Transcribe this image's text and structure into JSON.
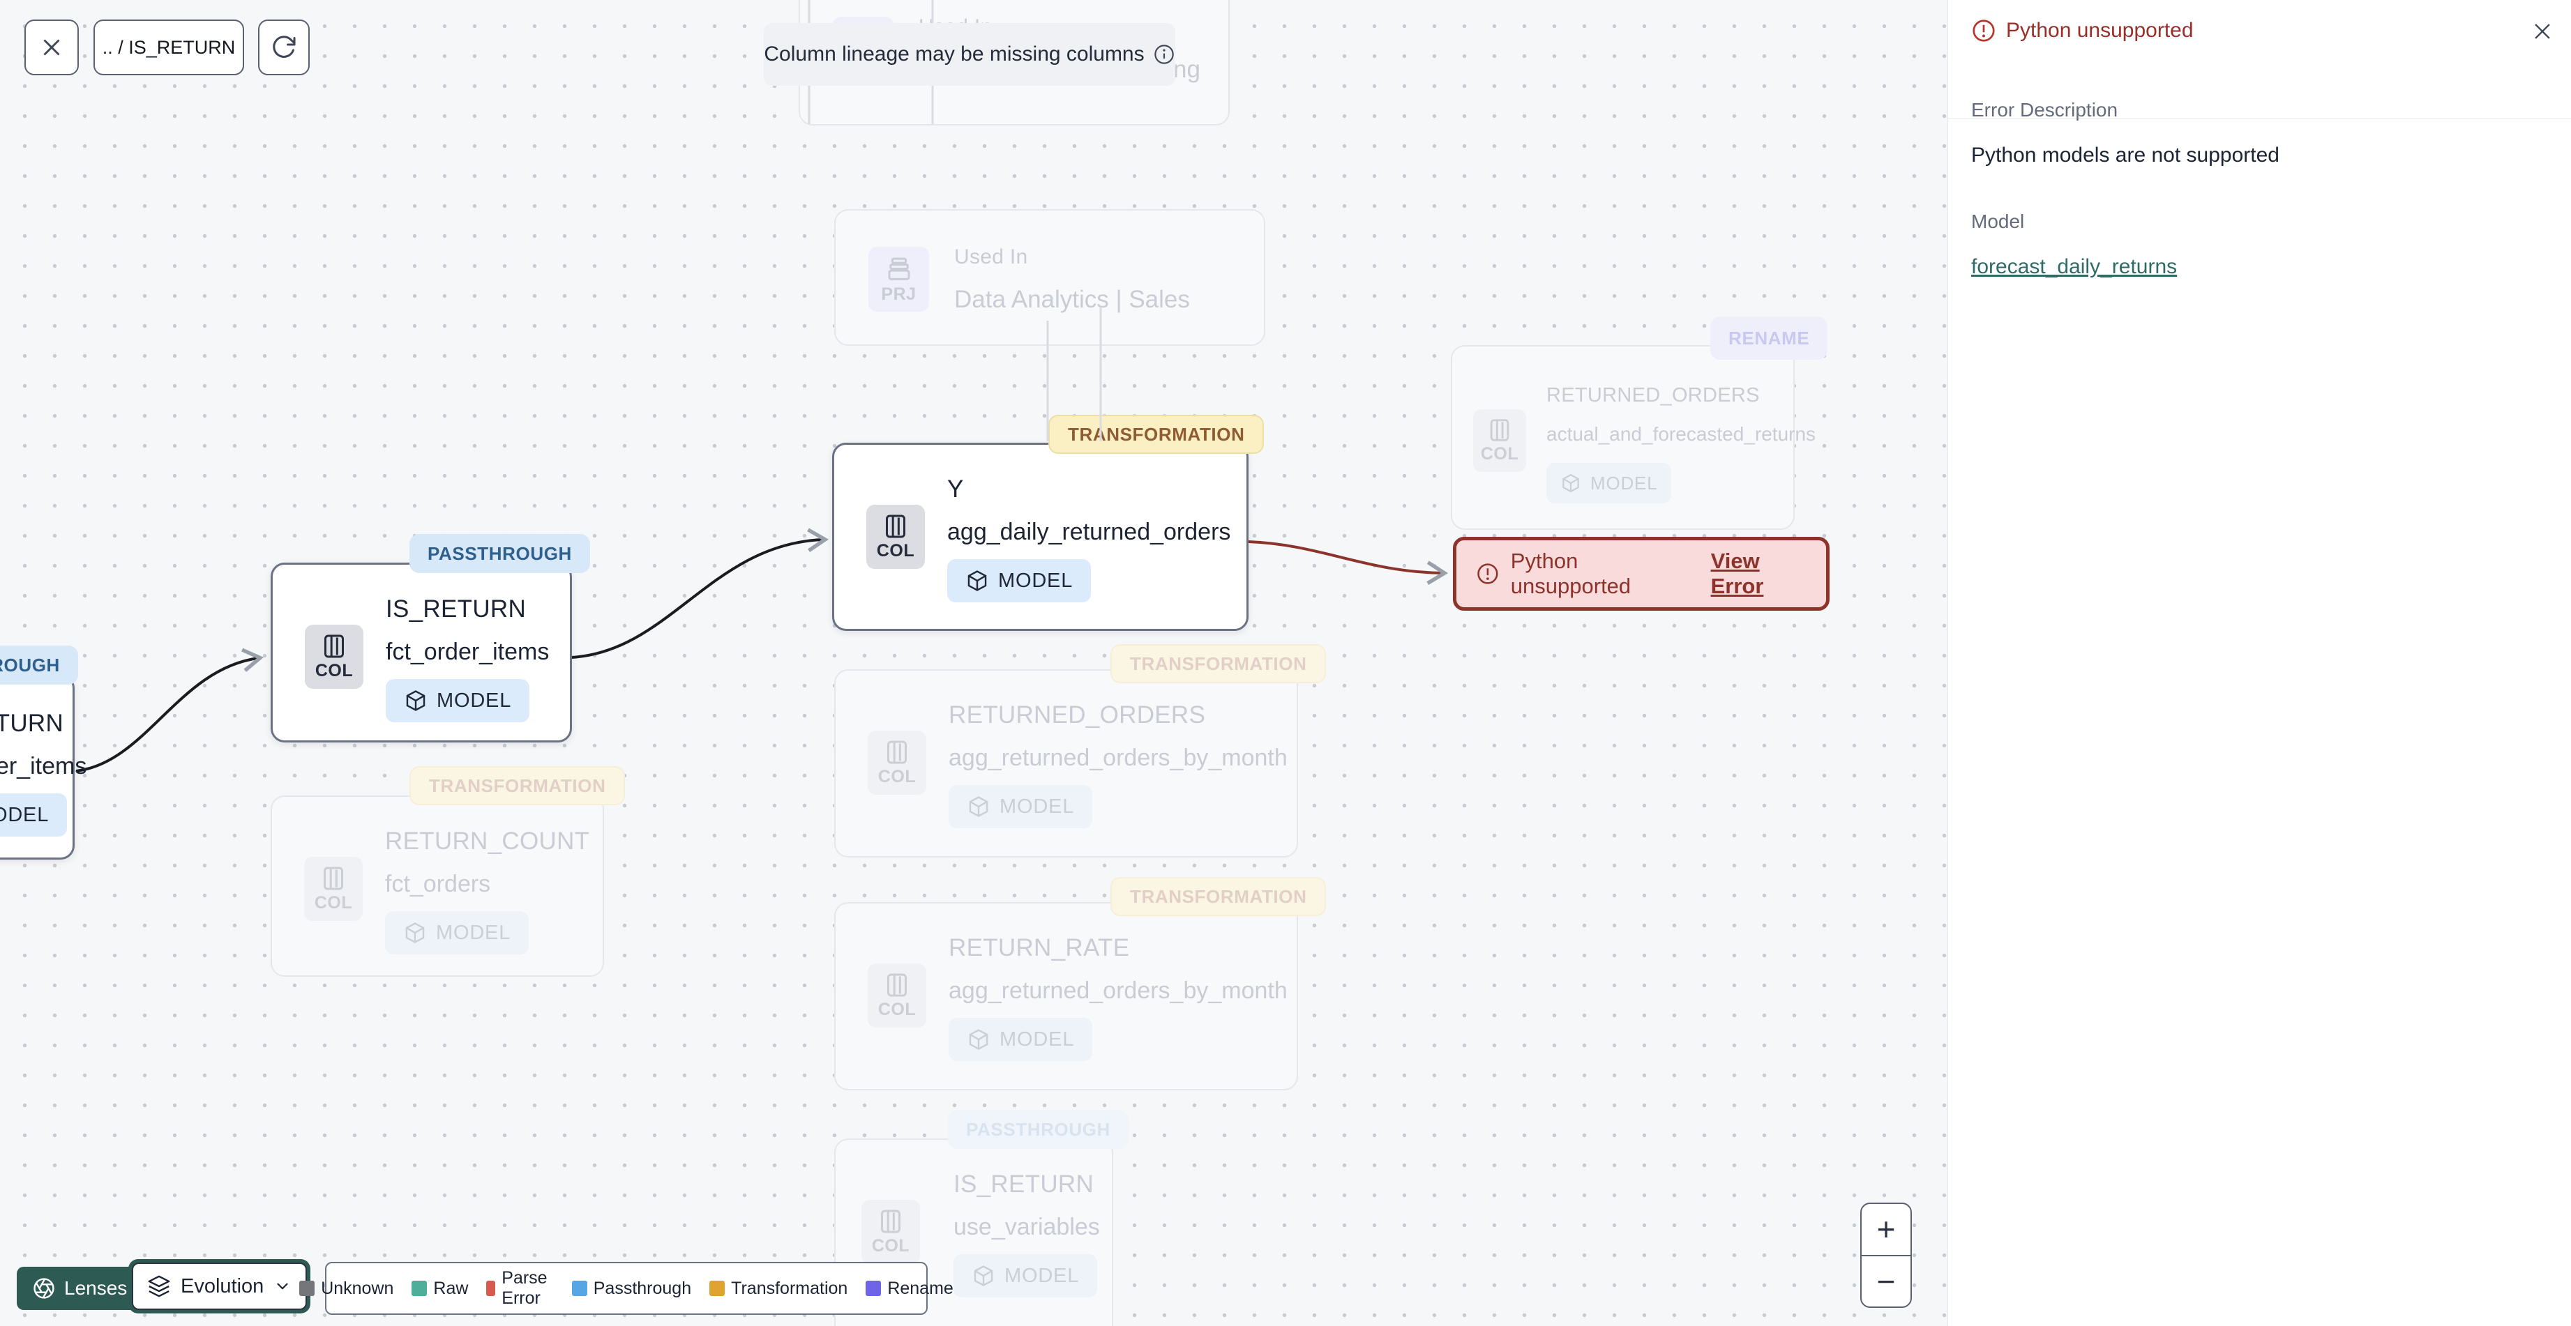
{
  "toolbar": {
    "breadcrumb": ".. / IS_RETURN"
  },
  "banner": {
    "text": "Column lineage may be missing columns"
  },
  "canvas": {
    "nodes": [
      {
        "badge": "PRJ",
        "title": "Used In",
        "subtitle": "Data Analytics | Marketing"
      },
      {
        "badge": "PRJ",
        "title": "Used In",
        "subtitle": "Data Analytics | Sales"
      },
      {
        "tag": "TRANSFORMATION",
        "badge": "COL",
        "title": "Y",
        "subtitle": "agg_daily_returned_orders",
        "model_label": "MODEL"
      },
      {
        "tag": "PASSTHROUGH",
        "badge": "COL",
        "title": "IS_RETURN",
        "subtitle": "fct_order_items",
        "model_label": "MODEL"
      },
      {
        "tag": "PASSTHROUGH",
        "badge": "COL",
        "title": "IS_RETURN",
        "subtitle": "fct_order_items",
        "model_label": "MODEL"
      },
      {
        "tag": "TRANSFORMATION",
        "badge": "COL",
        "title": "RETURN_COUNT",
        "subtitle": "fct_orders",
        "model_label": "MODEL"
      },
      {
        "tag": "TRANSFORMATION",
        "badge": "COL",
        "title": "RETURNED_ORDERS",
        "subtitle": "agg_returned_orders_by_month",
        "model_label": "MODEL"
      },
      {
        "tag": "TRANSFORMATION",
        "badge": "COL",
        "title": "RETURN_RATE",
        "subtitle": "agg_returned_orders_by_month",
        "model_label": "MODEL"
      },
      {
        "tag": "PASSTHROUGH",
        "badge": "COL",
        "title": "IS_RETURN",
        "subtitle": "use_variables",
        "model_label": "MODEL"
      },
      {
        "tag": "RENAME",
        "badge": "COL",
        "title": "RETURNED_ORDERS",
        "subtitle": "actual_and_forecasted_returns",
        "model_label": "MODEL"
      }
    ],
    "error_node": {
      "text": "Python unsupported",
      "link": "View Error"
    }
  },
  "panel": {
    "title": "Python unsupported",
    "error_description_label": "Error Description",
    "error_description": "Python models are not supported",
    "model_label": "Model",
    "model_link": "forecast_daily_returns"
  },
  "footer": {
    "lenses_label": "Lenses",
    "lens_selected": "Evolution",
    "legend": [
      {
        "label": "Unknown",
        "color": "#757679"
      },
      {
        "label": "Raw",
        "color": "#4FAE9A"
      },
      {
        "label": "Parse Error",
        "color": "#D85A4F"
      },
      {
        "label": "Passthrough",
        "color": "#56A6E3"
      },
      {
        "label": "Transformation",
        "color": "#DFA32F"
      },
      {
        "label": "Rename",
        "color": "#6F63E8"
      }
    ]
  },
  "zoom_controls": {
    "zoom_in": "+",
    "zoom_out": "−"
  },
  "colors": {
    "accent_teal": "#2D5A52",
    "error_red": "#8C332C",
    "panel_header_red": "#982F28",
    "link_teal": "#2E6B66",
    "transformation_tag": "#FAF0C4",
    "passthrough_tag": "#D7E8F9",
    "rename_tag": "#EFEFFB"
  }
}
